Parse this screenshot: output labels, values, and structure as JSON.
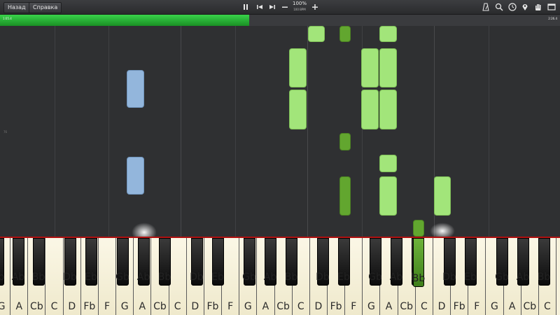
{
  "toolbar": {
    "back_label": "Назад",
    "help_label": "Справка",
    "speed_percent": "100%",
    "speed_bpm": "100 BPM",
    "icons": [
      "pause-icon",
      "skip-back-icon",
      "skip-forward-icon",
      "minus-icon",
      "plus-icon",
      "metronome-icon",
      "search-icon",
      "clock-icon",
      "map-pin-icon",
      "hand-icon",
      "window-icon"
    ]
  },
  "progress": {
    "elapsed": "1:05.4",
    "total": "2:26.4",
    "fraction": 0.445
  },
  "roll": {
    "marker": "76"
  },
  "keyboard": {
    "white_labels": [
      "G",
      "A",
      "Cb",
      "C",
      "D",
      "Fb",
      "F",
      "G",
      "A",
      "Cb",
      "C",
      "D",
      "Fb",
      "F",
      "G",
      "A",
      "Cb",
      "C",
      "D",
      "Fb",
      "F",
      "G",
      "A",
      "Cb",
      "C",
      "D",
      "Fb",
      "F",
      "G",
      "A",
      "Cb",
      "C"
    ],
    "black_labels": [
      "Bb",
      "Ab",
      "Bb",
      "Db",
      "Eb",
      "Gb",
      "Ab",
      "Bb",
      "Db",
      "Eb",
      "Gb",
      "Ab",
      "Bb",
      "Db",
      "Eb",
      "Gb",
      "Ab",
      "Bb",
      "Db",
      "Eb",
      "Gb",
      "Ab",
      "Bb"
    ],
    "pressed_label": "Bb"
  },
  "colors": {
    "right_hand": "#a2e57a",
    "right_hand_dark": "#62a62f",
    "left_hand": "#93b6dc",
    "progress": "#39d34a"
  }
}
